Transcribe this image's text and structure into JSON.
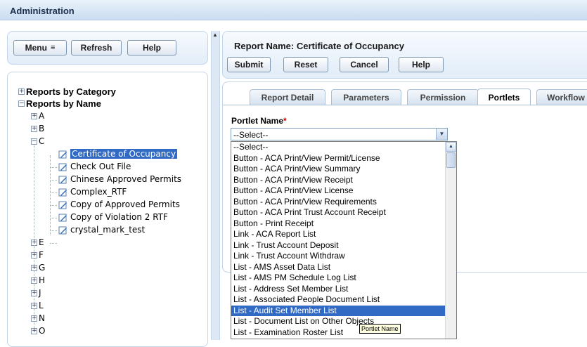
{
  "header": {
    "title": "Administration"
  },
  "left_toolbar": {
    "menu_label": "Menu",
    "menu_icon": "≡",
    "refresh_label": "Refresh",
    "help_label": "Help"
  },
  "tree": {
    "category_root": "Reports by Category",
    "name_root": "Reports by Name",
    "letters_top": [
      "A",
      "B",
      "C"
    ],
    "c_children": [
      "Certificate of Occupancy",
      "Check Out File",
      "Chinese Approved Permits",
      "Complex_RTF",
      "Copy of Approved Permits",
      "Copy of Violation 2 RTF",
      "crystal_mark_test"
    ],
    "letters_bottom": [
      "E",
      "F",
      "G",
      "H",
      "J",
      "L",
      "N",
      "O"
    ],
    "selected": "Certificate of Occupancy"
  },
  "report": {
    "title": "Report Name: Certificate of Occupancy",
    "submit_label": "Submit",
    "reset_label": "Reset",
    "cancel_label": "Cancel",
    "help_label": "Help"
  },
  "tabs": [
    "Report Detail",
    "Parameters",
    "Permission",
    "Portlets",
    "Workflow"
  ],
  "active_tab": "Portlets",
  "portlet": {
    "label": "Portlet Name",
    "required_mark": "*",
    "selected_value": "--Select--",
    "options": [
      "--Select--",
      "Button - ACA Print/View Permit/License",
      "Button - ACA Print/View Summary",
      "Button - ACA Print/View Receipt",
      "Button - ACA Print/View License",
      "Button - ACA Print/View Requirements",
      "Button - ACA Print Trust Account Receipt",
      "Button - Print Receipt",
      "Link - ACA Report List",
      "Link - Trust Account Deposit",
      "Link - Trust Account Withdraw",
      "List - AMS Asset Data List",
      "List - AMS PM Schedule Log List",
      "List - Address Set Member List",
      "List - Associated People Document List",
      "List - Audit Set Member List",
      "List - Document List on Other Objects",
      "List - Examination Roster List"
    ],
    "highlighted": "List - Audit Set Member List",
    "tooltip": "Portlet Name"
  }
}
